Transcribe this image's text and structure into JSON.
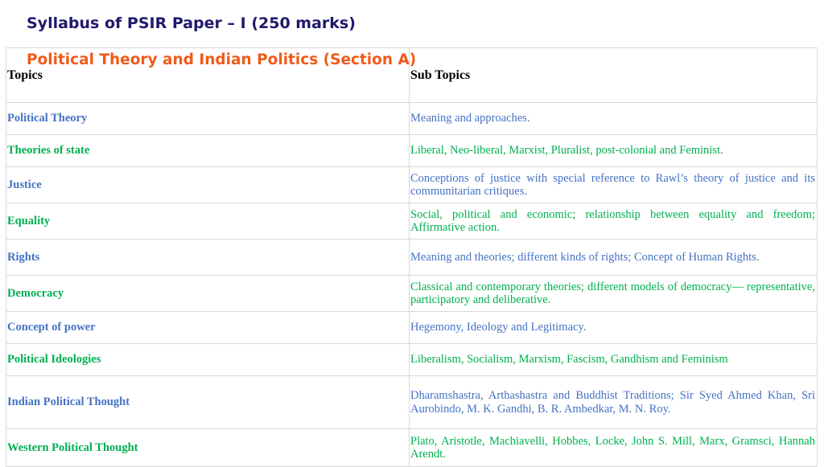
{
  "title": "Syllabus of PSIR Paper – I (250 marks)",
  "section_title": "Political Theory and Indian Politics (Section A)",
  "colors": {
    "title": "#1f1a6b",
    "section_title": "#f05a1a",
    "topic_blue": "#4472c4",
    "topic_green": "#00b050"
  },
  "table": {
    "headers": [
      "Topics",
      "Sub Topics"
    ],
    "rows": [
      {
        "topic": "Political Theory",
        "subtopics": "Meaning and approaches."
      },
      {
        "topic": "Theories of state",
        "subtopics": "Liberal, Neo-liberal, Marxist, Pluralist, post-colonial and Feminist."
      },
      {
        "topic": "Justice",
        "subtopics": "Conceptions of justice with special reference to Rawl’s theory of justice and its communitarian critiques."
      },
      {
        "topic": "Equality",
        "subtopics": "Social, political and economic; relationship between equality and freedom; Affirmative action."
      },
      {
        "topic": "Rights",
        "subtopics": "Meaning and theories; different kinds of rights; Concept of Human Rights."
      },
      {
        "topic": "Democracy",
        "subtopics": "Classical and contemporary theories; different models of democracy— representative, participatory and deliberative."
      },
      {
        "topic": "Concept of power",
        "subtopics": "Hegemony, Ideology and Legitimacy."
      },
      {
        "topic": "Political Ideologies",
        "subtopics": "Liberalism, Socialism, Marxism, Fascism, Gandhism and Feminism"
      },
      {
        "topic": "Indian Political Thought",
        "subtopics": "Dharamshastra, Arthashastra and Buddhist Traditions; Sir Syed Ahmed Khan, Sri Aurobindo, M. K. Gandhi, B. R. Ambedkar, M. N. Roy."
      },
      {
        "topic": "Western Political Thought",
        "subtopics": "Plato, Aristotle, Machiavelli, Hobbes, Locke, John S. Mill, Marx, Gramsci, Hannah Arendt."
      }
    ]
  }
}
